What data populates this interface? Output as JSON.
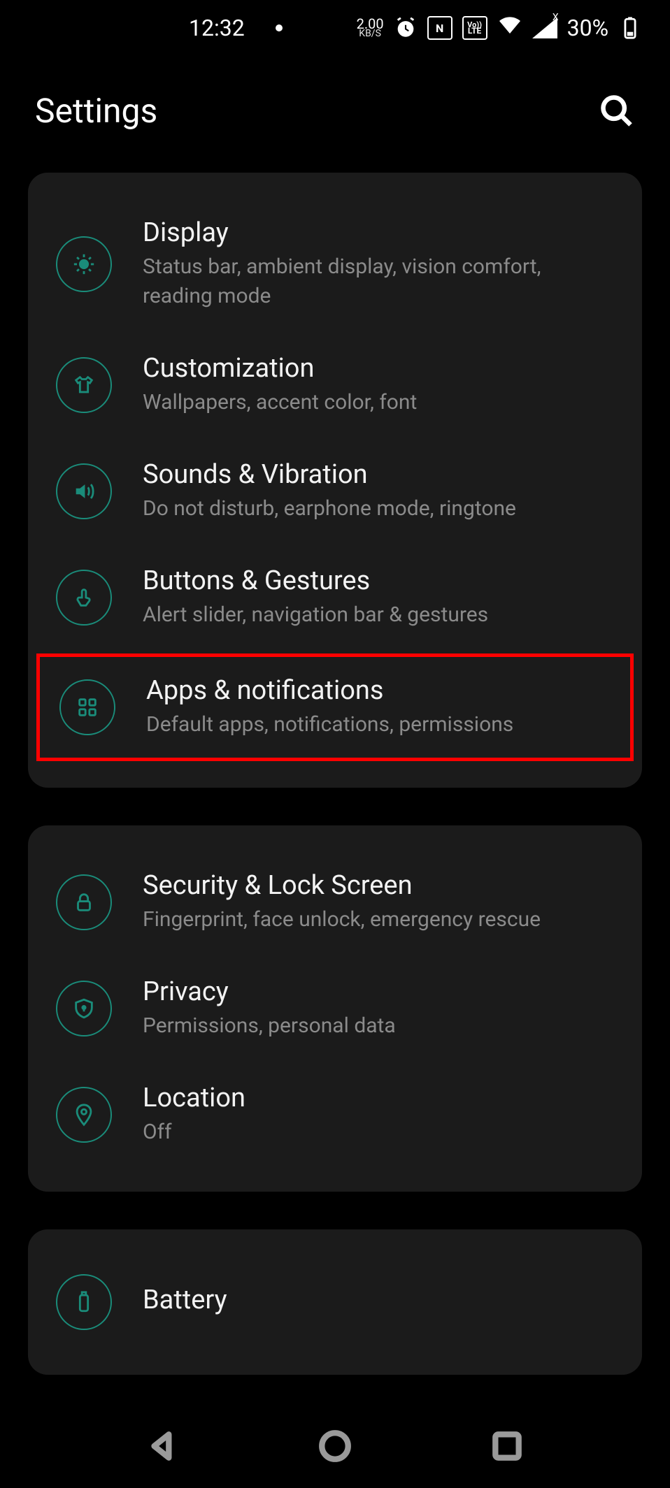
{
  "status": {
    "time": "12:32",
    "data_rate_value": "2.00",
    "data_rate_unit": "KB/S",
    "nfc_label": "N",
    "lte_top": "Vo))",
    "lte_bot": "LTE",
    "signal_badge": "X",
    "battery_percent": "30%"
  },
  "header": {
    "title": "Settings"
  },
  "groups": [
    {
      "items": [
        {
          "icon": "brightness",
          "title": "Display",
          "subtitle": "Status bar, ambient display, vision comfort, reading mode",
          "highlight": false
        },
        {
          "icon": "shirt",
          "title": "Customization",
          "subtitle": "Wallpapers, accent color, font",
          "highlight": false
        },
        {
          "icon": "volume",
          "title": "Sounds & Vibration",
          "subtitle": "Do not disturb, earphone mode, ringtone",
          "highlight": false
        },
        {
          "icon": "gesture",
          "title": "Buttons & Gestures",
          "subtitle": "Alert slider, navigation bar & gestures",
          "highlight": false
        },
        {
          "icon": "apps",
          "title": "Apps & notifications",
          "subtitle": "Default apps, notifications, permissions",
          "highlight": true
        }
      ]
    },
    {
      "items": [
        {
          "icon": "lock",
          "title": "Security & Lock Screen",
          "subtitle": "Fingerprint, face unlock, emergency rescue",
          "highlight": false
        },
        {
          "icon": "shield",
          "title": "Privacy",
          "subtitle": "Permissions, personal data",
          "highlight": false
        },
        {
          "icon": "pin",
          "title": "Location",
          "subtitle": "Off",
          "highlight": false
        }
      ]
    },
    {
      "items": [
        {
          "icon": "battery",
          "title": "Battery",
          "subtitle": "",
          "highlight": false
        }
      ]
    }
  ]
}
